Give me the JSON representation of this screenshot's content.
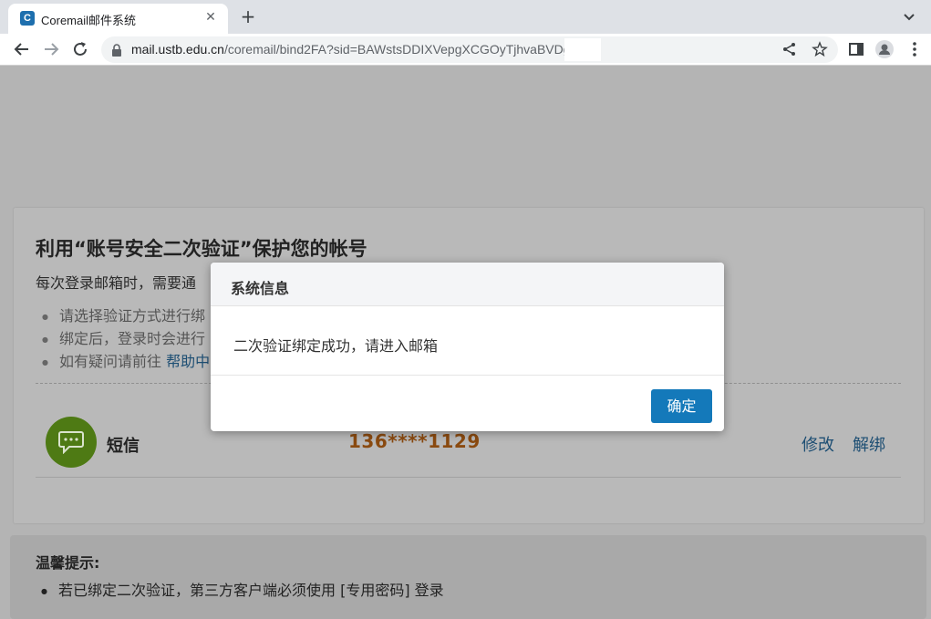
{
  "browser": {
    "tab_title": "Coremail邮件系统",
    "favicon_letter": "C",
    "url_host": "mail.ustb.edu.cn",
    "url_path": "/coremail/bind2FA?sid=BAWstsDDIXVepgXCGOyTjhvaBVDg"
  },
  "page": {
    "title": "利用“账号安全二次验证”保护您的帐号",
    "description": "每次登录邮箱时，需要通",
    "bullets": [
      "请选择验证方式进行绑",
      "绑定后，登录时会进行",
      "如有疑问请前往"
    ],
    "help_link": "帮助中",
    "method": {
      "label": "短信",
      "phone": "136****1129",
      "edit": "修改",
      "unbind": "解绑"
    },
    "tips": {
      "title": "温馨提示:",
      "item": "若已绑定二次验证，第三方客户端必须使用 [专用密码] 登录"
    }
  },
  "modal": {
    "title": "系统信息",
    "message": "二次验证绑定成功，请进入邮箱",
    "ok_label": "确定"
  },
  "colors": {
    "accent": "#1479ba",
    "sms_icon": "#4e7a14",
    "phone_text": "#8a4a10",
    "link": "#1d4e73"
  }
}
